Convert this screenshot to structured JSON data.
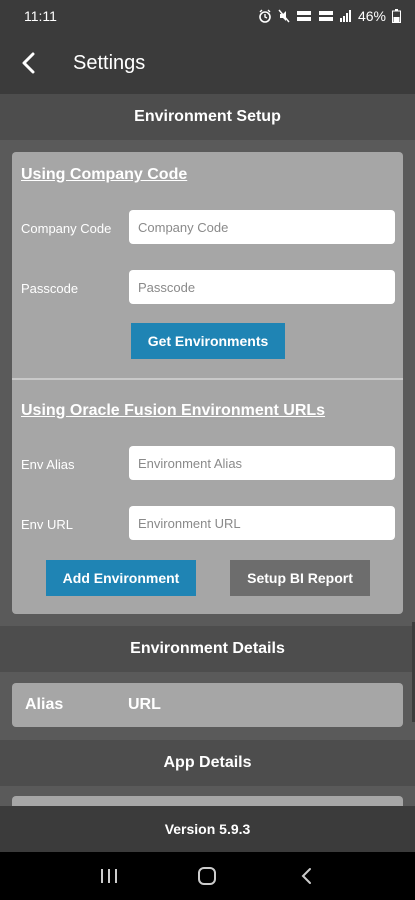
{
  "status_bar": {
    "time": "11:11",
    "battery": "46%"
  },
  "app_bar": {
    "title": "Settings"
  },
  "environment_setup": {
    "header": "Environment Setup",
    "company_code_section": {
      "title": "Using Company Code",
      "company_code_label": "Company Code",
      "company_code_placeholder": "Company Code",
      "passcode_label": "Passcode",
      "passcode_placeholder": "Passcode",
      "get_environments_label": "Get Environments"
    },
    "fusion_urls_section": {
      "title": "Using Oracle Fusion Environment URLs",
      "env_alias_label": "Env Alias",
      "env_alias_placeholder": "Environment Alias",
      "env_url_label": "Env URL",
      "env_url_placeholder": "Environment URL",
      "add_environment_label": "Add Environment",
      "setup_bi_report_label": "Setup BI Report"
    }
  },
  "environment_details": {
    "header": "Environment Details",
    "columns": [
      "Alias",
      "URL"
    ]
  },
  "app_details": {
    "header": "App Details"
  },
  "footer": {
    "version": "Version 5.9.3"
  },
  "colors": {
    "primary_button": "#1f84b4",
    "secondary_button": "#6d6d6d",
    "card": "#a6a6a6",
    "app_bar": "#3b3b3b"
  }
}
